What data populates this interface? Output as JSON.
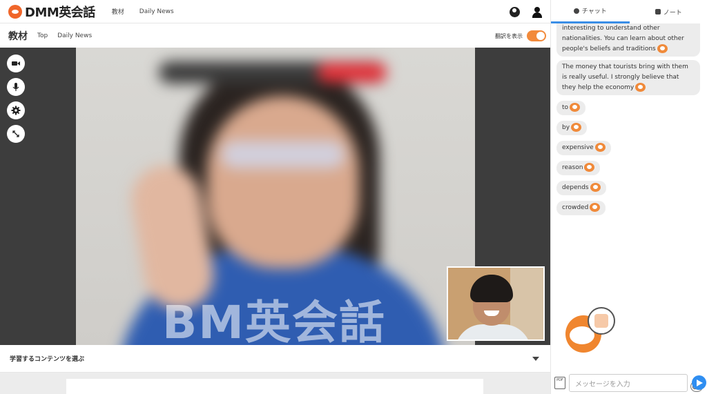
{
  "app": {
    "logo_text": "DMM英会話"
  },
  "topnav": {
    "links": [
      "教材",
      "Daily News"
    ]
  },
  "subheader": {
    "title": "教材",
    "links": [
      "Top",
      "Daily News"
    ],
    "translate_label": "翻訳を表示",
    "translate_on": true
  },
  "video": {
    "watermark": "BM英会話",
    "controls": [
      "video-camera-icon",
      "microphone-icon",
      "gear-icon",
      "fullscreen-icon"
    ]
  },
  "content_select": {
    "label": "学習するコンテンツを選ぶ"
  },
  "tabs": [
    {
      "label": "チャット",
      "active": true
    },
    {
      "label": "ノート",
      "active": false
    }
  ],
  "chat": {
    "messages": [
      "interesting to understand other nationalities. You can learn about other people's beliefs and traditions",
      "The money that tourists bring with them is really useful. I strongly believe that they help the economy",
      "to",
      "by",
      "expensive",
      "reason",
      "depends",
      "crowded"
    ]
  },
  "input": {
    "placeholder": "メッセージを入力",
    "pdf_label": "PDF"
  },
  "colors": {
    "accent": "#f0662a",
    "toggle": "#f28a3b",
    "send": "#2f8ef1",
    "tab_active": "#3a8ee6"
  }
}
